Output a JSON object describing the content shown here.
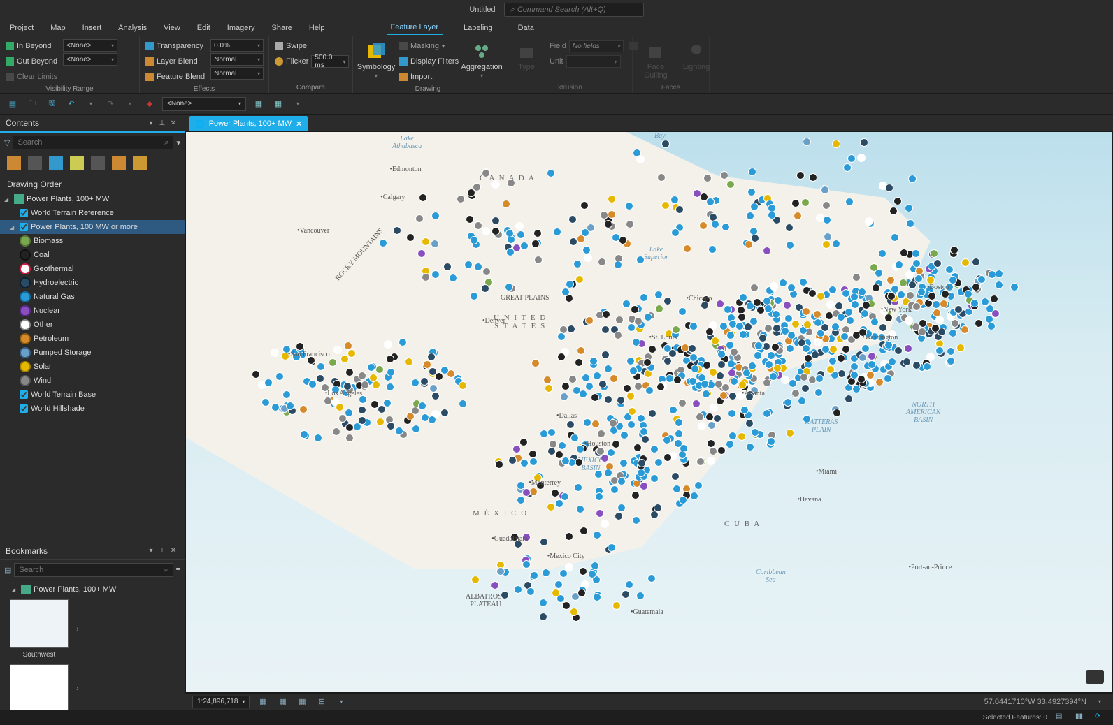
{
  "app": {
    "title": "Untitled",
    "command_search_placeholder": "Command Search (Alt+Q)"
  },
  "menu": {
    "items": [
      "Project",
      "Map",
      "Insert",
      "Analysis",
      "View",
      "Edit",
      "Imagery",
      "Share",
      "Help"
    ],
    "context_tabs": [
      "Feature Layer",
      "Labeling",
      "Data"
    ],
    "active_context": "Feature Layer"
  },
  "ribbon": {
    "visibility": {
      "caption": "Visibility Range",
      "in_beyond_label": "In Beyond",
      "out_beyond_label": "Out Beyond",
      "clear_limits_label": "Clear Limits",
      "in_beyond_value": "<None>",
      "out_beyond_value": "<None>"
    },
    "effects": {
      "caption": "Effects",
      "transparency_label": "Transparency",
      "transparency_value": "0.0%",
      "layer_blend_label": "Layer Blend",
      "layer_blend_value": "Normal",
      "feature_blend_label": "Feature Blend",
      "feature_blend_value": "Normal"
    },
    "compare": {
      "caption": "Compare",
      "swipe_label": "Swipe",
      "flicker_label": "Flicker",
      "flicker_value": "500.0  ms"
    },
    "drawing": {
      "caption": "Drawing",
      "symbology_label": "Symbology",
      "masking_label": "Masking",
      "display_filters_label": "Display Filters",
      "import_label": "Import",
      "aggregation_label": "Aggregation"
    },
    "extrusion": {
      "caption": "Extrusion",
      "type_label": "Type",
      "field_label": "Field",
      "field_value": "No fields",
      "unit_label": "Unit",
      "unit_value": ""
    },
    "faces": {
      "caption": "Faces",
      "face_culling_label": "Face Culling",
      "lighting_label": "Lighting"
    }
  },
  "qat": {
    "combo_value": "<None>"
  },
  "contents": {
    "title": "Contents",
    "search_placeholder": "Search",
    "section": "Drawing Order",
    "map_node": "Power Plants, 100+ MW",
    "layers": [
      {
        "label": "World Terrain Reference",
        "checked": true
      },
      {
        "label": "Power Plants, 100 MW or more",
        "checked": true,
        "selected": true,
        "expanded": true
      }
    ],
    "legend": [
      {
        "label": "Biomass",
        "fill": "#7aa84d",
        "border": "#5a7a38"
      },
      {
        "label": "Coal",
        "fill": "#222",
        "border": "#111"
      },
      {
        "label": "Geothermal",
        "fill": "#fff",
        "border": "#c24"
      },
      {
        "label": "Hydroelectric",
        "fill": "#2b4a63",
        "border": "#102030"
      },
      {
        "label": "Natural Gas",
        "fill": "#2a9bd6",
        "border": "#156a9a"
      },
      {
        "label": "Nuclear",
        "fill": "#8a4fbf",
        "border": "#5a2a8a"
      },
      {
        "label": "Other",
        "fill": "#fff",
        "border": "#888"
      },
      {
        "label": "Petroleum",
        "fill": "#d68a2a",
        "border": "#8a5a10"
      },
      {
        "label": "Pumped Storage",
        "fill": "#6aa0c8",
        "border": "#3a6088"
      },
      {
        "label": "Solar",
        "fill": "#e6b800",
        "border": "#a08000"
      },
      {
        "label": "Wind",
        "fill": "#888",
        "border": "#555"
      }
    ],
    "base_layers": [
      {
        "label": "World Terrain Base",
        "checked": true
      },
      {
        "label": "World Hillshade",
        "checked": true
      }
    ]
  },
  "bookmarks": {
    "title": "Bookmarks",
    "search_placeholder": "Search",
    "group": "Power Plants, 100+ MW",
    "items": [
      {
        "label": "Southwest"
      }
    ]
  },
  "map": {
    "tab_title": "Power Plants, 100+ MW",
    "scale": "1:24,896,718",
    "coords": "57.0441710°W 33.4927394°N",
    "labels": {
      "canada": "C A N A D A",
      "us": "U N I T E D\nS T A T E S",
      "mexico": "M É X I C O",
      "cuba": "C U B A",
      "athabasca": "Lake\nAthabasca",
      "superior": "Lake\nSuperior",
      "bay": "Bay",
      "great_plains": "GREAT PLAINS",
      "mexico_basin": "MEXICO\nBASIN",
      "hatteras": "HATTERAS\nPLAIN",
      "na_basin": "NORTH\nAMERICAN\nBASIN",
      "caribbean": "Caribbean\nSea",
      "albatross": "ALBATROSS\nPLATEAU",
      "rocky": "ROCKY MOUNTAINS"
    },
    "cities": [
      "Vancouver",
      "Calgary",
      "Edmonton",
      "Denver",
      "San Francisco",
      "Los Angeles",
      "Dallas",
      "Houston",
      "Chicago",
      "St. Louis",
      "New York",
      "Washington",
      "Atlanta",
      "Boston",
      "Miami",
      "Havana",
      "Monterrey",
      "Guadalajara",
      "Mexico City",
      "Guatemala",
      "Port-au-Prince"
    ]
  },
  "status": {
    "selected_features": "Selected Features: 0"
  }
}
